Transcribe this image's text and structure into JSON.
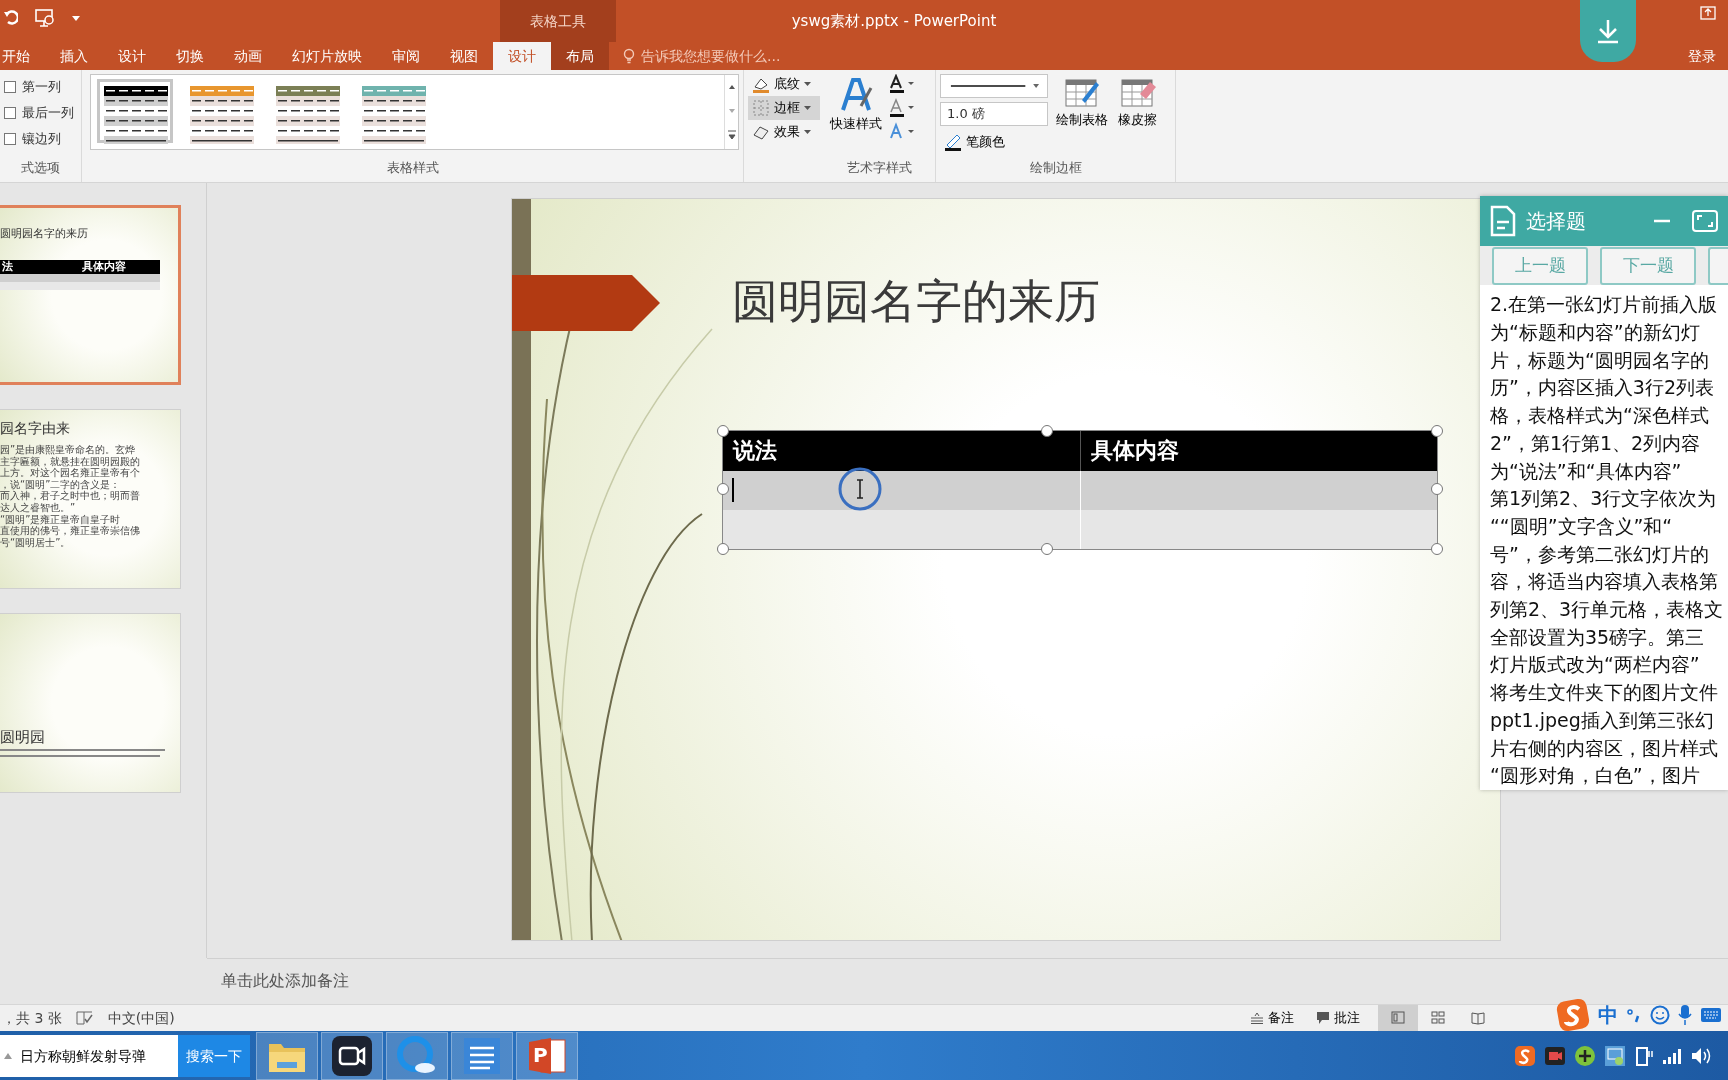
{
  "window": {
    "title": "yswg素材.pptx - PowerPoint",
    "context_group": "表格工具",
    "sign_in": "登录"
  },
  "ribbon_tabs": [
    {
      "label": "开始",
      "selected": false,
      "contextual": false
    },
    {
      "label": "插入",
      "selected": false,
      "contextual": false
    },
    {
      "label": "设计",
      "selected": false,
      "contextual": false
    },
    {
      "label": "切换",
      "selected": false,
      "contextual": false
    },
    {
      "label": "动画",
      "selected": false,
      "contextual": false
    },
    {
      "label": "幻灯片放映",
      "selected": false,
      "contextual": false
    },
    {
      "label": "审阅",
      "selected": false,
      "contextual": false
    },
    {
      "label": "视图",
      "selected": false,
      "contextual": false
    },
    {
      "label": "设计",
      "selected": true,
      "contextual": true
    },
    {
      "label": "布局",
      "selected": false,
      "contextual": true
    }
  ],
  "tell_me": {
    "placeholder": "告诉我您想要做什么..."
  },
  "style_options": {
    "label": "式选项",
    "checkboxes": [
      {
        "label": "第一列",
        "checked": false
      },
      {
        "label": "最后一列",
        "checked": false
      },
      {
        "label": "镶边列",
        "checked": false
      }
    ]
  },
  "table_styles": {
    "label": "表格样式",
    "styles": [
      {
        "color": "#000000",
        "selected": true
      },
      {
        "color": "#e8962e",
        "selected": false
      },
      {
        "color": "#7b7f55",
        "selected": false
      },
      {
        "color": "#6fb3ad",
        "selected": false
      }
    ]
  },
  "shading_buttons": [
    {
      "label": "底纹",
      "kind": "shading",
      "active": false
    },
    {
      "label": "边框",
      "kind": "border",
      "active": true
    },
    {
      "label": "效果",
      "kind": "effects",
      "active": false
    }
  ],
  "wordart": {
    "label": "艺术字样式",
    "quick_styles": "快速样式"
  },
  "draw_borders": {
    "label": "绘制边框",
    "pen_weight": "1.0 磅",
    "pen_color": "笔颜色",
    "draw_table": "绘制表格",
    "eraser": "橡皮擦"
  },
  "thumbnails": [
    {
      "selected": true,
      "title": "圆明园名字的来历",
      "table_headers": [
        "法",
        "具体内容"
      ]
    },
    {
      "selected": false,
      "title": "园名字由来",
      "lines": [
        "园”是由康熙皇帝命名的。玄烨",
        "主字匾额，就悬挂在圆明园殿的",
        "上方。对这个园名雍正皇帝有个",
        "，说“圆明”二字的含义是：",
        "而入神，君子之时中也；明而普",
        "达人之睿智也。”",
        "“圆明”是雍正皇帝自皇子时",
        "直使用的佛号，雍正皇帝崇信佛",
        "号“圆明居士”。"
      ]
    },
    {
      "selected": false,
      "title": "圆明园"
    }
  ],
  "slide": {
    "title": "圆明园名字的来历",
    "table": {
      "columns": [
        "说法",
        "具体内容"
      ]
    }
  },
  "notes": {
    "placeholder": "单击此处添加备注"
  },
  "status_bar": {
    "slide_count": "，共 3 张",
    "language": "中文(中国)",
    "notes": "备注",
    "comments": "批注",
    "views": [
      {
        "kind": "normal",
        "selected": true
      },
      {
        "kind": "sorter",
        "selected": false
      },
      {
        "kind": "reading",
        "selected": false
      }
    ]
  },
  "ime": {
    "mode": "中"
  },
  "question_panel": {
    "title": "选择题",
    "buttons": [
      "上一题",
      "下一题"
    ],
    "lines": [
      "2.在第一张幻灯片前插入版",
      "为“标题和内容”的新幻灯",
      "片，标题为“圆明园名字的",
      "历”，内容区插入3行2列表",
      "格，表格样式为“深色样式",
      "2”，第1行第1、2列内容",
      "为“说法”和“具体内容”",
      "第1列第2、3行文字依次为",
      "““圆明”文字含义”和“",
      "号”，参考第二张幻灯片的",
      "容，将适当内容填入表格第",
      "列第2、3行单元格，表格文",
      "全部设置为35磅字。第三",
      "灯片版式改为“两栏内容”",
      "将考生文件夹下的图片文件",
      "ppt1.jpeg插入到第三张幻",
      "片右侧的内容区，图片样式",
      "“圆形对角，白色”，图片"
    ]
  },
  "taskbar": {
    "search": {
      "value": "日方称朝鲜发射导弹"
    },
    "search_button": "搜索一下",
    "apps": [
      {
        "kind": "folder"
      },
      {
        "kind": "camera"
      },
      {
        "kind": "browser"
      },
      {
        "kind": "notes"
      },
      {
        "kind": "powerpoint",
        "letter": "P"
      }
    ]
  }
}
